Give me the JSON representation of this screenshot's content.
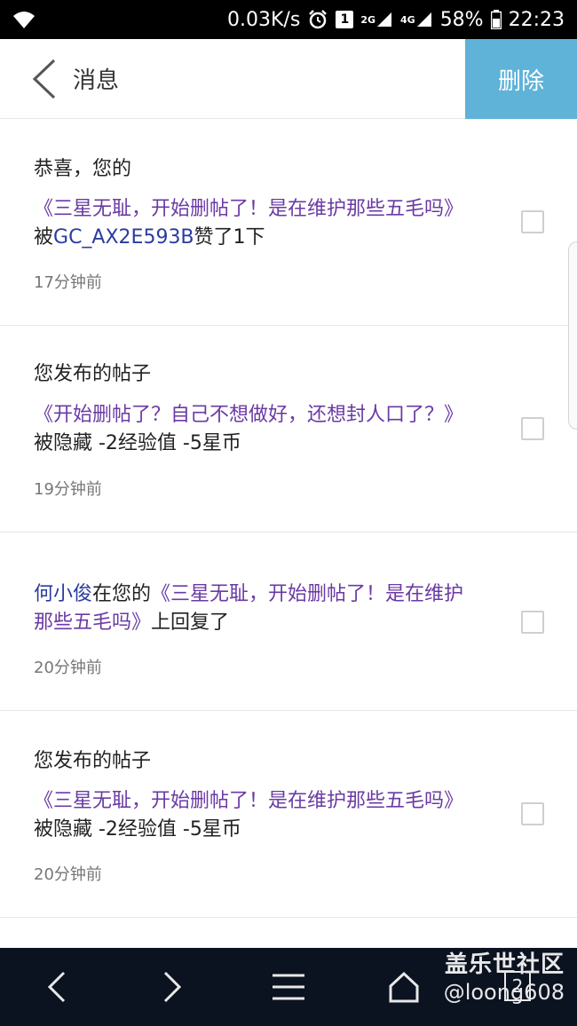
{
  "status_bar": {
    "speed": "0.03K/s",
    "sim_badge": "1",
    "network_2g": "2G",
    "network_4g": "4G",
    "battery": "58%",
    "time": "22:23"
  },
  "header": {
    "title": "消息",
    "delete_label": "删除"
  },
  "messages": [
    {
      "title": "恭喜，您的",
      "post": "《三星无耻，开始删帖了！是在维护那些五毛吗》",
      "mid": "被",
      "user": "GC_AX2E593B",
      "suffix": "赞了1下",
      "time": "17分钟前"
    },
    {
      "title": "您发布的帖子",
      "post": "《开始删帖了？自己不想做好，还想封人口了？》",
      "suffix": "被隐藏 -2经验值 -5星币",
      "time": "19分钟前"
    },
    {
      "user": "何小俊",
      "mid": "在您的",
      "post": "《三星无耻，开始删帖了！是在维护那些五毛吗》",
      "suffix": "上回复了",
      "time": "20分钟前"
    },
    {
      "title": "您发布的帖子",
      "post": "《三星无耻，开始删帖了！是在维护那些五毛吗》",
      "suffix": "被隐藏 -2经验值 -5星币",
      "time": "20分钟前"
    }
  ],
  "bottom_nav": {
    "tab_count": "2",
    "watermark_title": "盖乐世社区",
    "watermark_user": "@loong608"
  },
  "icons": {
    "wifi": "wifi-icon",
    "alarm": "alarm-icon",
    "back": "chevron-left-icon",
    "forward": "chevron-right-icon",
    "menu": "menu-icon",
    "home": "home-icon"
  }
}
